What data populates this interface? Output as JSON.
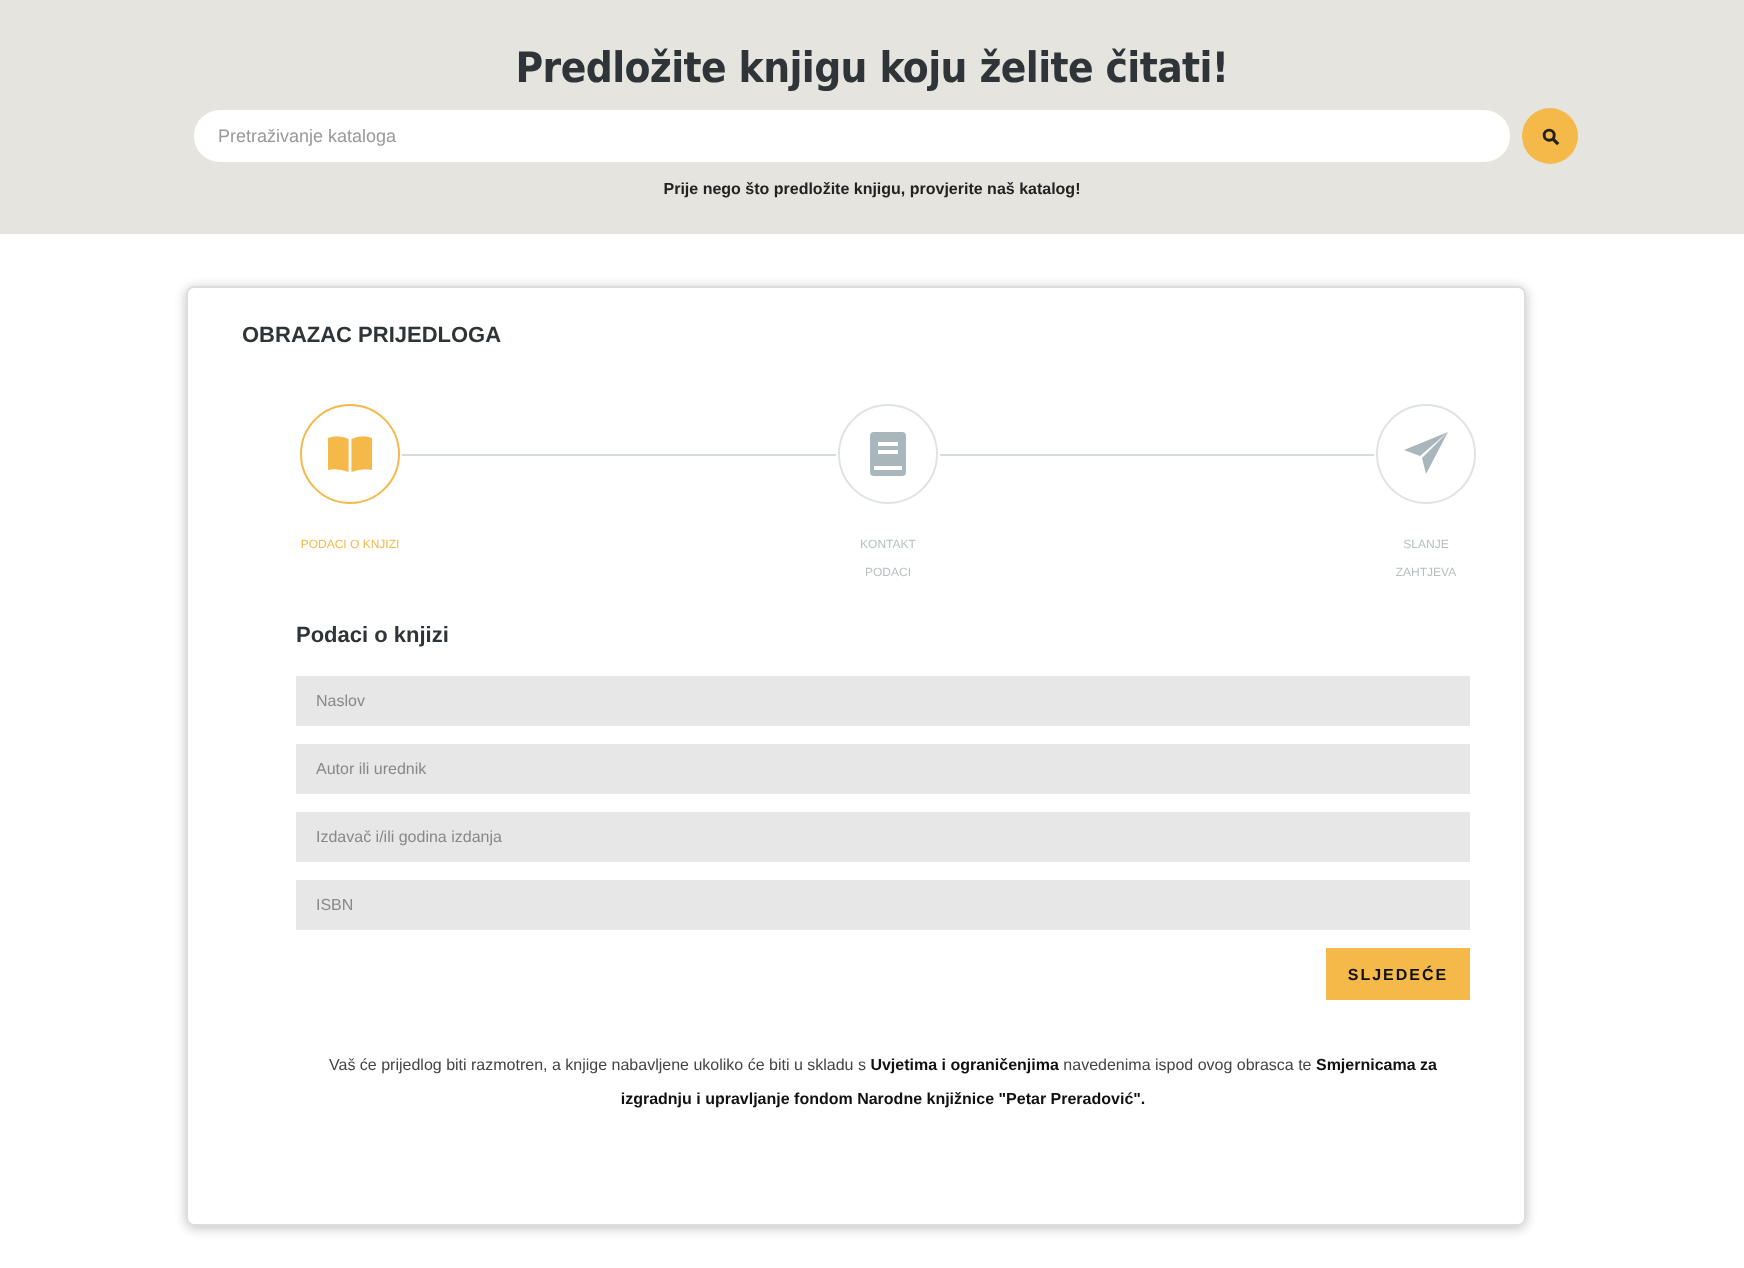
{
  "header": {
    "title": "Predložite knjigu koju želite čitati!",
    "search": {
      "placeholder": "Pretraživanje kataloga"
    },
    "note": "Prije nego što predložite knjigu, provjerite naš katalog!"
  },
  "form": {
    "title": "OBRAZAC PRIJEDLOGA",
    "steps": [
      {
        "kind": "book",
        "label": "PODACI O KNJIZI",
        "selected": true
      },
      {
        "kind": "contact",
        "label": "KONTAKT PODACI",
        "selected": false
      },
      {
        "kind": "send",
        "label": "SLANJE ZAHTJEVA",
        "selected": false
      }
    ],
    "section_title": "Podaci o knjizi",
    "fields": [
      {
        "placeholder": "Naslov"
      },
      {
        "placeholder": "Autor ili urednik"
      },
      {
        "placeholder": "Izdavač i/ili godina izdanja"
      },
      {
        "placeholder": "ISBN"
      }
    ],
    "next_button": "SLJEDEĆE",
    "notice": "Vaš će prijedlog biti razmotren, a knjige nabavljene ukoliko će biti u skladu s **Uvjetima i ograničenjima** navedenima ispod ovog obrasca te **Smjernicama za izgradnju i upravljanje fondom Narodne knjižnice \"Petar Preradović\".**"
  }
}
